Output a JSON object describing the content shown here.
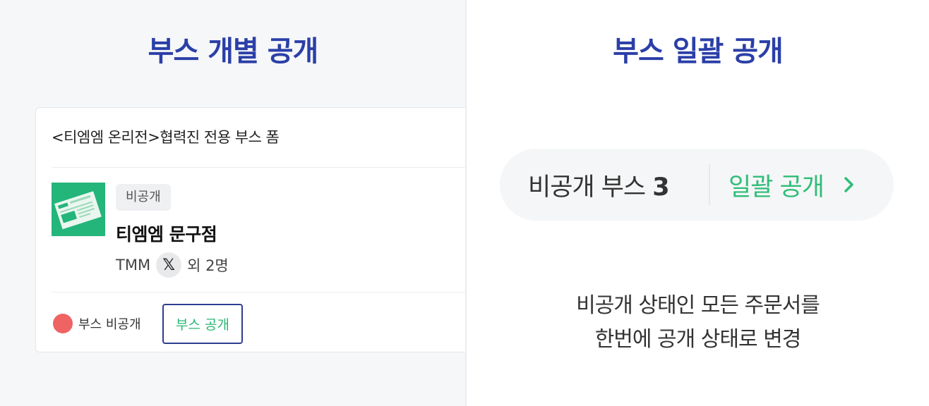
{
  "left_panel": {
    "title": "부스 개별 공개",
    "card": {
      "form_title": "<티엠엠 온리전>협력진 전용 부스 폼",
      "badge": "비공개",
      "shop_name": "티엠엠 문구점",
      "member_primary": "TMM",
      "member_icon": "x-logo-icon",
      "member_icon_glyph": "𝕏",
      "member_extra": "외 2명",
      "status_label": "부스 비공개",
      "status_color": "#ef6363",
      "open_button": "부스 공개"
    }
  },
  "right_panel": {
    "title": "부스 일괄 공개",
    "pill": {
      "private_label": "비공개 부스",
      "private_count": "3",
      "bulk_open_label": "일괄 공개",
      "chevron_icon": "chevron-right-icon"
    },
    "description_line1": "비공개 상태인 모든 주문서를",
    "description_line2": "한번에 공개 상태로 변경"
  },
  "colors": {
    "title": "#2b3fa8",
    "accent_green": "#2fbd78",
    "button_border": "#2e3f8f"
  }
}
